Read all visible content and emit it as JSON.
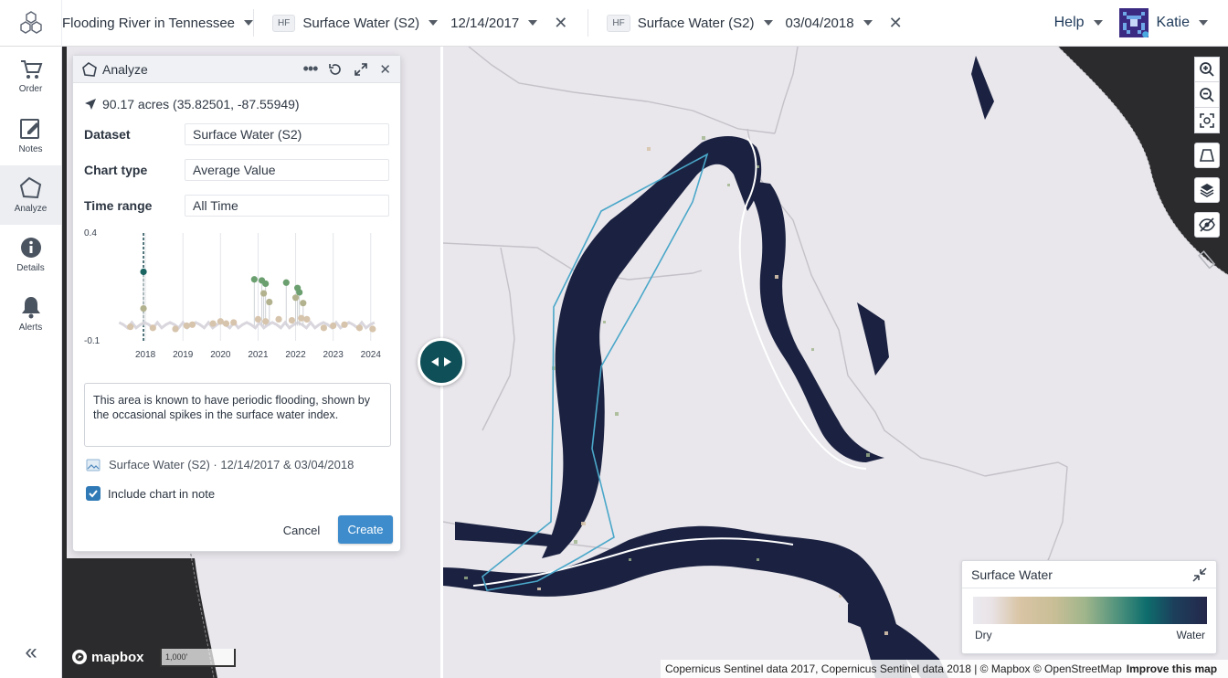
{
  "topbar": {
    "project_title": "Flooding River in Tennessee",
    "left_layer": {
      "badge": "HF",
      "dataset": "Surface Water (S2)",
      "date": "12/14/2017"
    },
    "right_layer": {
      "badge": "HF",
      "dataset": "Surface Water (S2)",
      "date": "03/04/2018"
    },
    "help_label": "Help",
    "user_name": "Katie"
  },
  "rail": {
    "items": [
      {
        "label": "Order",
        "icon": "cart-icon"
      },
      {
        "label": "Notes",
        "icon": "note-edit-icon"
      },
      {
        "label": "Analyze",
        "icon": "polygon-icon",
        "active": true
      },
      {
        "label": "Details",
        "icon": "info-icon"
      },
      {
        "label": "Alerts",
        "icon": "bell-icon"
      }
    ],
    "collapse_label": "«"
  },
  "panel": {
    "title": "Analyze",
    "location": "90.17 acres (35.82501, -87.55949)",
    "fields": [
      {
        "label": "Dataset",
        "value": "Surface Water (S2)"
      },
      {
        "label": "Chart type",
        "value": "Average Value"
      },
      {
        "label": "Time range",
        "value": "All Time"
      }
    ],
    "note_text": "This area is known to have periodic flooding, shown by the occasional spikes in the surface water index.",
    "attachment": "Surface Water (S2) · 12/14/2017 & 03/04/2018",
    "include_chart_label": "Include chart in note",
    "cancel_label": "Cancel",
    "create_label": "Create"
  },
  "chart_data": {
    "type": "scatter",
    "title": "",
    "xlabel": "",
    "ylabel": "",
    "x_ticks": [
      "2018",
      "2019",
      "2020",
      "2021",
      "2022",
      "2023",
      "2024"
    ],
    "y_ticks": [
      "0.4",
      "-0.1"
    ],
    "ylim": [
      -0.1,
      0.4
    ],
    "xlim": [
      2017.0,
      2024.2
    ],
    "grid": true,
    "highlight_x": 2017.95,
    "series": [
      {
        "color": "#1a6462",
        "points": [
          [
            2017.95,
            0.22
          ]
        ]
      },
      {
        "color": "#6b9f6f",
        "points": [
          [
            2020.9,
            0.185
          ],
          [
            2021.1,
            0.18
          ],
          [
            2021.2,
            0.165
          ],
          [
            2021.75,
            0.17
          ],
          [
            2022.05,
            0.145
          ],
          [
            2022.1,
            0.125
          ]
        ]
      },
      {
        "color": "#b3b28f",
        "points": [
          [
            2017.95,
            0.05
          ],
          [
            2021.15,
            0.12
          ],
          [
            2021.3,
            0.08
          ],
          [
            2022.0,
            0.1
          ],
          [
            2022.2,
            0.075
          ]
        ]
      },
      {
        "color": "#d7c4ac",
        "points": [
          [
            2017.6,
            -0.035
          ],
          [
            2018.2,
            -0.04
          ],
          [
            2018.8,
            -0.045
          ],
          [
            2019.1,
            -0.03
          ],
          [
            2019.25,
            -0.025
          ],
          [
            2019.8,
            -0.02
          ],
          [
            2020.0,
            -0.01
          ],
          [
            2020.15,
            -0.02
          ],
          [
            2020.35,
            -0.015
          ],
          [
            2021.0,
            0.0
          ],
          [
            2021.2,
            -0.01
          ],
          [
            2021.55,
            0.0
          ],
          [
            2021.9,
            -0.005
          ],
          [
            2022.15,
            0.005
          ],
          [
            2022.3,
            0.0
          ],
          [
            2022.75,
            -0.04
          ],
          [
            2023.0,
            -0.03
          ],
          [
            2023.3,
            -0.025
          ],
          [
            2023.7,
            -0.04
          ],
          [
            2024.05,
            -0.045
          ]
        ]
      }
    ]
  },
  "legend": {
    "title": "Surface Water",
    "low_label": "Dry",
    "high_label": "Water",
    "ramp": [
      "#ebeaef",
      "#d9c4a4",
      "#9fb58b",
      "#0e6e6d",
      "#25274a"
    ]
  },
  "map": {
    "scale_label": "1,000'",
    "mapbox_label": "mapbox",
    "attribution": "Copernicus Sentinel data 2017, Copernicus Sentinel data 2018 | © Mapbox © OpenStreetMap",
    "improve_label": "Improve this map"
  },
  "colors": {
    "water": "#1b2241",
    "land": "#e9e7ec",
    "dark_basemap": "#2b2b2d",
    "aoi_outline": "#4aa7c9",
    "accent": "#0f4f57"
  }
}
